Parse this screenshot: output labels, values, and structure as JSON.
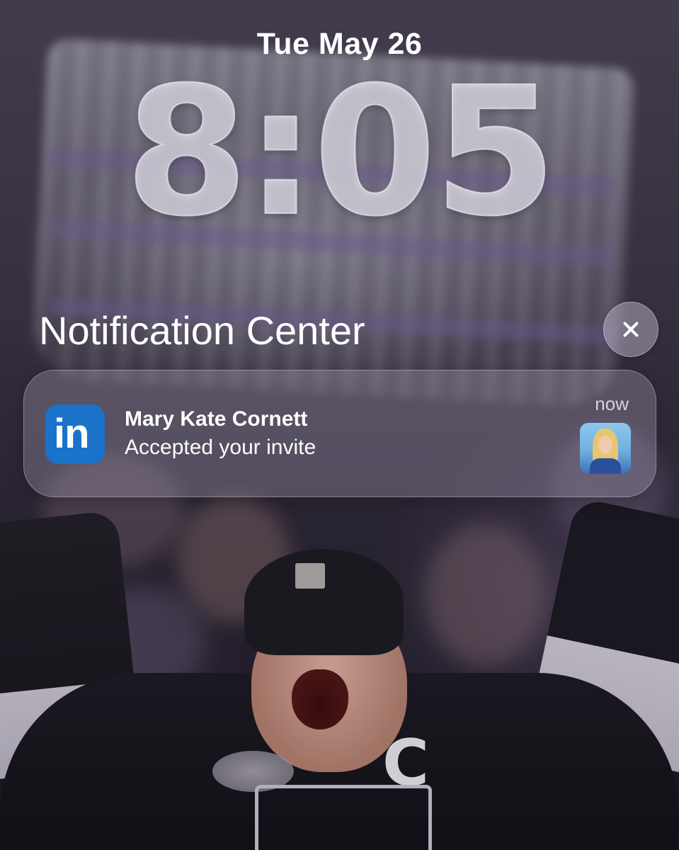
{
  "lock_screen": {
    "date": "Tue May 26",
    "time": "8:05"
  },
  "notification_center": {
    "title": "Notification Center",
    "close_icon": "xmark-icon"
  },
  "notifications": [
    {
      "app_icon": "linkedin-icon",
      "app_icon_text": "in",
      "sender": "Mary Kate Cornett",
      "message": "Accepted your invite",
      "time": "now",
      "avatar": "contact-photo"
    }
  ],
  "colors": {
    "linkedin_blue": "#1a72c9",
    "notification_bg": "rgba(175,168,190,0.32)"
  }
}
